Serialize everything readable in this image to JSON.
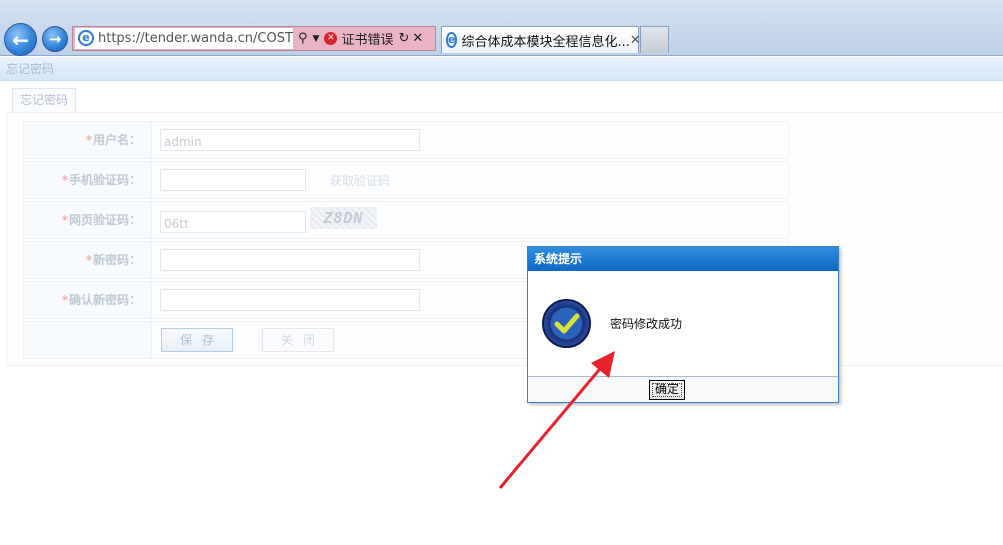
{
  "browser": {
    "url": "https://tender.wanda.cn/COST/co",
    "cert_error": "证书错误",
    "tab_title": "综合体成本模块全程信息化...",
    "colors": {
      "address_error_bg": "#e9b3c3",
      "nav_button": "#2f7fd6"
    }
  },
  "page": {
    "header_title": "忘记密码",
    "tab_label": "忘记密码",
    "form": {
      "required_mark": "*",
      "username": {
        "label": "用户名：",
        "value": "admin"
      },
      "sms_code": {
        "label": "手机验证码：",
        "value": "",
        "get_code_link": "获取验证码"
      },
      "captcha": {
        "label": "网页验证码：",
        "value": "06tt",
        "image_text": "Z8DN"
      },
      "new_password": {
        "label": "新密码：",
        "value": ""
      },
      "confirm_password": {
        "label": "确认新密码：",
        "value": ""
      },
      "save_button": "保存",
      "close_button": "关闭"
    }
  },
  "dialog": {
    "title": "系统提示",
    "message": "密码修改成功",
    "ok_button": "确定",
    "icon": "success-check-icon",
    "colors": {
      "title_bar": "#1a78d4"
    }
  },
  "annotation": {
    "arrow_color": "#e8222a",
    "icon": "red-arrow-icon"
  }
}
